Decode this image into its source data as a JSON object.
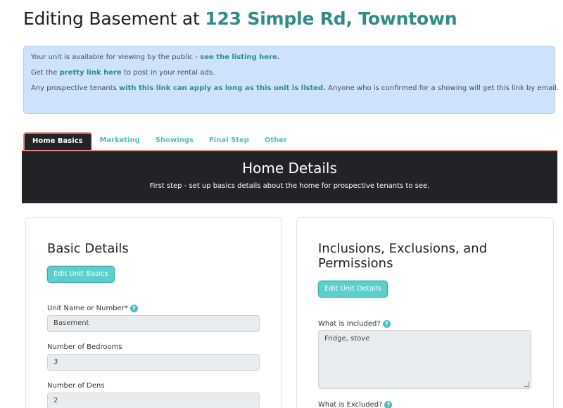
{
  "header": {
    "title_prefix": "Editing Basement at ",
    "title_address": "123 Simple Rd, Towntown"
  },
  "info": {
    "line1_text": "Your unit is available for viewing by the public - ",
    "line1_link": "see the listing here.",
    "line2_pre": "Get the ",
    "line2_link": "pretty link here",
    "line2_post": " to post in your rental ads.",
    "line3_pre": "Any prospective tenants ",
    "line3_link": "with this link can apply as long as this unit is listed.",
    "line3_post": " Anyone who is confirmed for a showing will get this link by email."
  },
  "tabs": [
    {
      "label": "Home Basics",
      "active": true
    },
    {
      "label": "Marketing",
      "active": false
    },
    {
      "label": "Showings",
      "active": false
    },
    {
      "label": "Final Step",
      "active": false
    },
    {
      "label": "Other",
      "active": false
    }
  ],
  "banner": {
    "title": "Home Details",
    "subtitle": "First step - set up basics details about the home for prospective tenants to see."
  },
  "basic": {
    "title": "Basic Details",
    "button": "Edit Unit Basics",
    "unit_name_label": "Unit Name or Number*",
    "unit_name_value": "Basement",
    "bedrooms_label": "Number of Bedrooms",
    "bedrooms_value": "3",
    "dens_label": "Number of Dens",
    "dens_value": "2"
  },
  "inclusions": {
    "title": "Inclusions, Exclusions, and Permissions",
    "button": "Edit Unit Details",
    "included_label": "What is Included?",
    "included_value": "Fridge, stove",
    "excluded_label": "What is Excluded?"
  },
  "icons": {
    "help": "question-circle-icon",
    "resize": "resize-grip-icon"
  },
  "colors": {
    "accent": "#2e8b88",
    "button": "#5ccfcd",
    "tab_border": "#e8877f",
    "dark": "#222327",
    "info_bg": "#cfe2fb"
  }
}
